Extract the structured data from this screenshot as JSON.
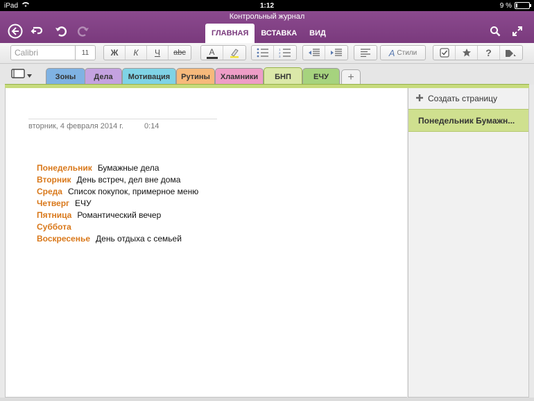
{
  "status": {
    "device": "iPad",
    "time": "1:12",
    "battery": "9 %",
    "battery_level": 0.09
  },
  "header": {
    "title": "Контрольный журнал",
    "tabs": [
      {
        "label": "ГЛАВНАЯ",
        "active": true
      },
      {
        "label": "ВСТАВКА",
        "active": false
      },
      {
        "label": "ВИД",
        "active": false
      }
    ],
    "icons": [
      "back-circle-icon",
      "sync-icon",
      "undo-icon",
      "redo-icon",
      "search-icon",
      "fullscreen-icon"
    ]
  },
  "ribbon": {
    "font_placeholder": "Calibri",
    "font_size": "11",
    "bold": "Ж",
    "italic": "К",
    "underline": "Ч",
    "strikethrough": "abc",
    "font_color_label": "A",
    "styles_label": "Стили",
    "help_label": "?"
  },
  "sections": [
    {
      "label": "Зоны",
      "color": "#7fb2e3"
    },
    {
      "label": "Дела",
      "color": "#c4a2e0"
    },
    {
      "label": "Мотивация",
      "color": "#7fd3e6"
    },
    {
      "label": "Рутины",
      "color": "#f6b97b"
    },
    {
      "label": "Хламники",
      "color": "#ee9dc7"
    },
    {
      "label": "БНП",
      "color": "#dbe8a9",
      "active": true
    },
    {
      "label": "ЕЧУ",
      "color": "#a6d37e"
    }
  ],
  "note": {
    "date": "вторник, 4 февраля 2014 г.",
    "time": "0:14",
    "days": [
      {
        "name": "Понедельник",
        "task": "Бумажные дела"
      },
      {
        "name": "Вторник",
        "task": "День встреч, дел вне дома"
      },
      {
        "name": "Среда",
        "task": "Список покупок, примерное меню"
      },
      {
        "name": "Четверг",
        "task": "ЕЧУ"
      },
      {
        "name": "Пятница",
        "task": "Романтический вечер"
      },
      {
        "name": "Суббота",
        "task": ""
      },
      {
        "name": "Воскресенье",
        "task": "День отдыха с семьей"
      }
    ]
  },
  "pages": {
    "create_label": "Создать страницу",
    "items": [
      {
        "label": "Понедельник   Бумажн...",
        "selected": true
      }
    ]
  },
  "colors": {
    "accent": "#7a3a7d",
    "day_name": "#d9781a",
    "section_green": "#c7db7d"
  }
}
